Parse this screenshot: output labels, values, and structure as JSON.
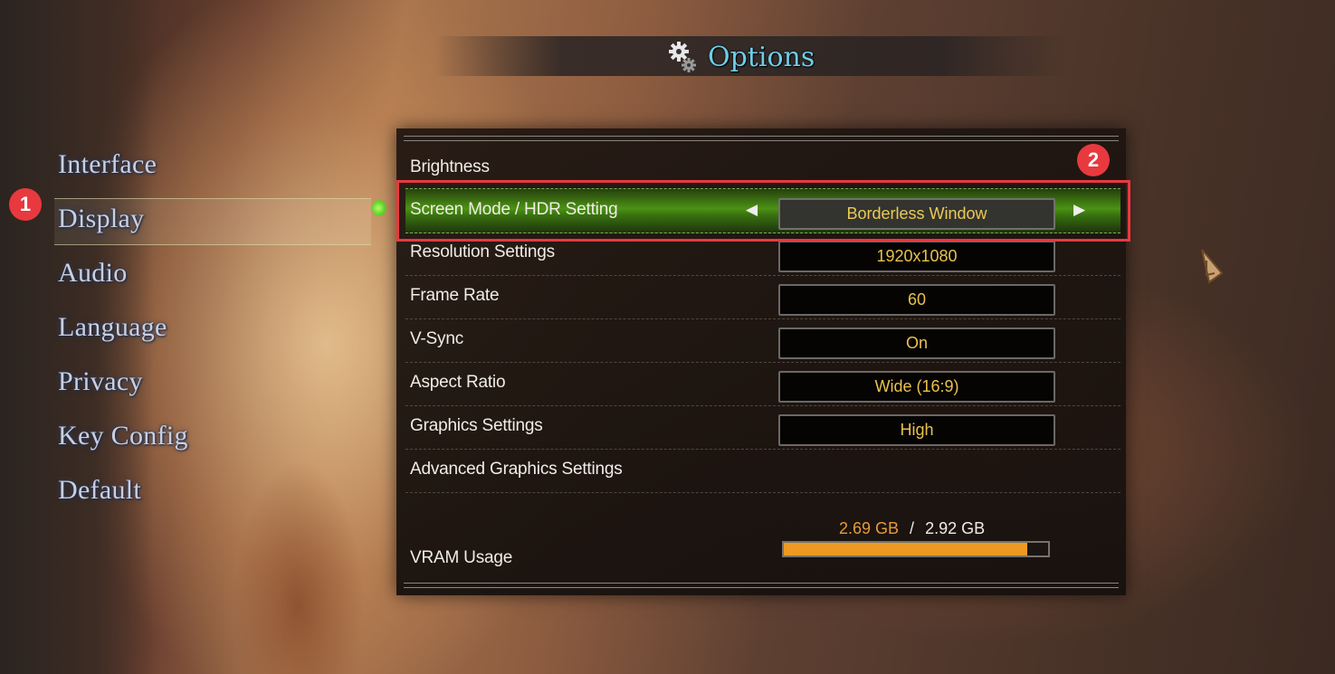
{
  "header": {
    "title": "Options",
    "icon": "gear-icon"
  },
  "sidebar": {
    "items": [
      {
        "label": "Interface"
      },
      {
        "label": "Display",
        "active": true
      },
      {
        "label": "Audio"
      },
      {
        "label": "Language"
      },
      {
        "label": "Privacy"
      },
      {
        "label": "Key Config"
      },
      {
        "label": "Default"
      }
    ]
  },
  "annotations": {
    "badge1": "1",
    "badge2": "2"
  },
  "settings": {
    "rows": [
      {
        "label": "Brightness"
      },
      {
        "label": "Screen Mode / HDR Setting",
        "value": "Borderless Window",
        "selected": true,
        "prev_icon": "◀",
        "next_icon": "▶"
      },
      {
        "label": "Resolution Settings",
        "value": "1920x1080"
      },
      {
        "label": "Frame Rate",
        "value": "60"
      },
      {
        "label": "V-Sync",
        "value": "On"
      },
      {
        "label": "Aspect Ratio",
        "value": "Wide (16:9)"
      },
      {
        "label": "Graphics Settings",
        "value": "High"
      },
      {
        "label": "Advanced Graphics Settings"
      }
    ]
  },
  "vram": {
    "label": "VRAM Usage",
    "used": "2.69 GB",
    "separator": "/",
    "total": "2.92 GB",
    "fraction": 0.921
  },
  "colors": {
    "accent_title": "#6ecde8",
    "value_text": "#e9c24c",
    "selected_row": "#5fb01e",
    "annotation": "#e8393f",
    "vram_fill": "#ee9a22"
  }
}
